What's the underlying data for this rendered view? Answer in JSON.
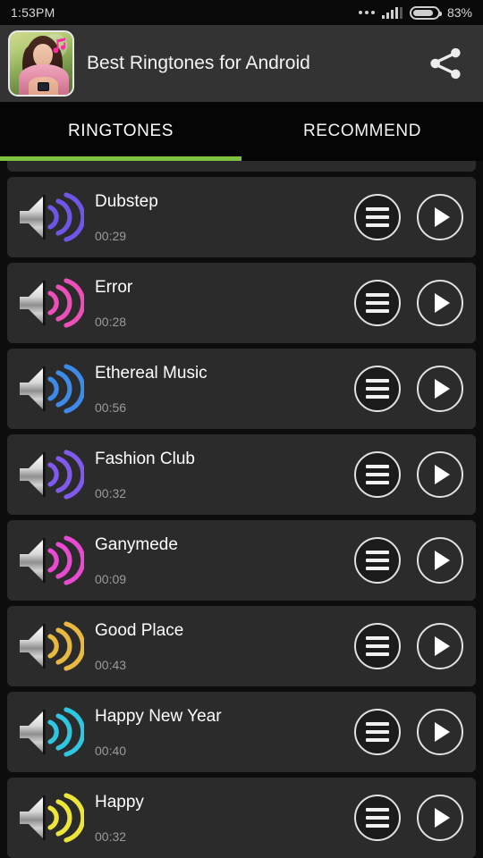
{
  "status_bar": {
    "time": "1:53PM",
    "battery_percent": "83%",
    "battery_level": 83,
    "icons": [
      "more-dots-icon",
      "signal-icon",
      "battery-icon"
    ]
  },
  "header": {
    "title": "Best Ringtones for Android",
    "app_icon_name": "app-thumbnail",
    "share_icon_name": "share-icon",
    "background": "#333333"
  },
  "tabs": {
    "items": [
      {
        "label": "RINGTONES",
        "active": true
      },
      {
        "label": "RECOMMEND",
        "active": false
      }
    ],
    "indicator_color": "#7ec242"
  },
  "list": {
    "scrolled_partial_row_above": true,
    "rows": [
      {
        "title": "Dubstep",
        "duration": "00:29",
        "wave_color": "#6f56e8",
        "menu_label": "options",
        "play_label": "play"
      },
      {
        "title": "Error",
        "duration": "00:28",
        "wave_color": "#ec4fb8",
        "menu_label": "options",
        "play_label": "play"
      },
      {
        "title": "Ethereal Music",
        "duration": "00:56",
        "wave_color": "#3d8ae8",
        "menu_label": "options",
        "play_label": "play"
      },
      {
        "title": "Fashion Club",
        "duration": "00:32",
        "wave_color": "#8059ef",
        "menu_label": "options",
        "play_label": "play"
      },
      {
        "title": "Ganymede",
        "duration": "00:09",
        "wave_color": "#e84bd0",
        "menu_label": "options",
        "play_label": "play"
      },
      {
        "title": "Good Place",
        "duration": "00:43",
        "wave_color": "#e8b840",
        "menu_label": "options",
        "play_label": "play"
      },
      {
        "title": "Happy New Year",
        "duration": "00:40",
        "wave_color": "#2ec6e0",
        "menu_label": "options",
        "play_label": "play"
      },
      {
        "title": "Happy",
        "duration": "00:32",
        "wave_color": "#ece53a",
        "menu_label": "options",
        "play_label": "play"
      }
    ]
  },
  "colors": {
    "screen_bg": "#0d0d0d",
    "row_bg": "#2b2b2b",
    "header_bg": "#333333",
    "tab_bg": "#050505",
    "title_text": "#ffffff",
    "duration_text": "#9a9a9a"
  }
}
